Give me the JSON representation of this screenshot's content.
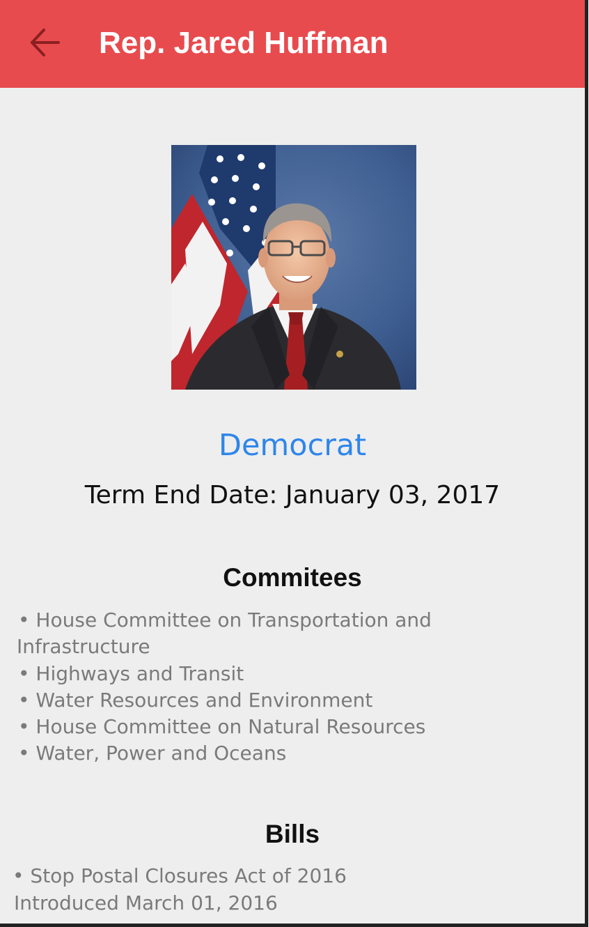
{
  "appbar": {
    "title": "Rep. Jared Huffman",
    "back_icon": "arrow-left-icon",
    "background": "#e84b4e"
  },
  "profile": {
    "photo_alt": "Portrait of Rep. Jared Huffman with American flag",
    "party": "Democrat",
    "party_color": "#2e86ea",
    "term_end": "Term End Date: January 03, 2017"
  },
  "committees": {
    "title": "Commitees",
    "bullet": "•",
    "items": [
      {
        "line1": "House Committee on Transportation and",
        "line2": "Infrastructure"
      },
      {
        "line1": "Highways and Transit"
      },
      {
        "line1": "Water Resources and Environment"
      },
      {
        "line1": "House Committee on Natural Resources"
      },
      {
        "line1": "Water, Power and Oceans"
      }
    ]
  },
  "bills": {
    "title": "Bills",
    "bullet": "•",
    "items": [
      {
        "name": "Stop Postal Closures Act of 2016",
        "introduced": "Introduced March 01, 2016"
      }
    ]
  }
}
